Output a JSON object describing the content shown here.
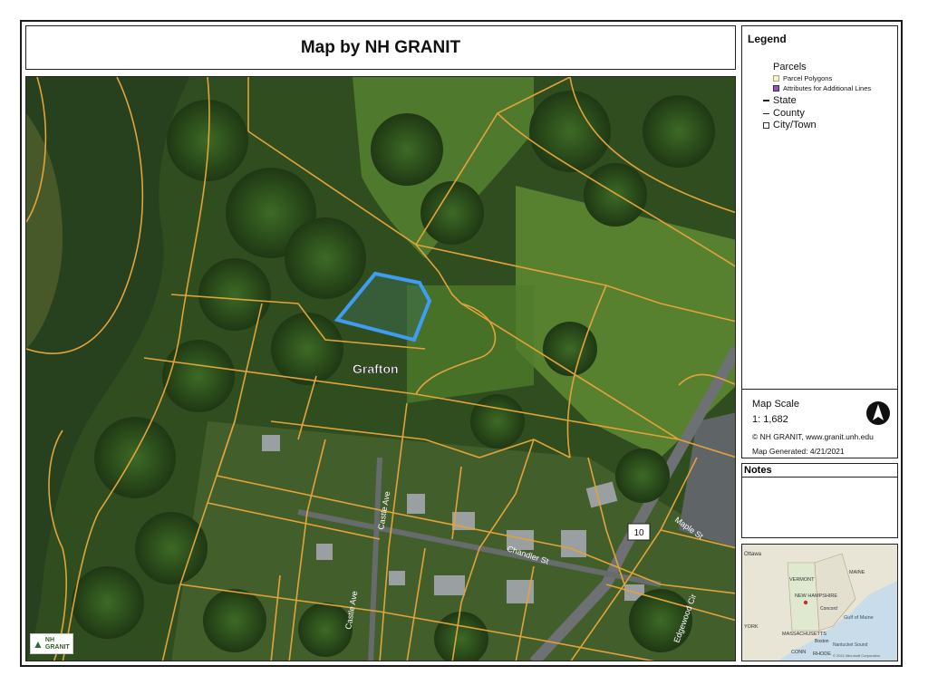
{
  "title": "Map by NH GRANIT",
  "legend": {
    "heading": "Legend",
    "group": "Parcels",
    "items": [
      {
        "label": "Parcel Polygons",
        "color": "#f2efe0",
        "icon": "parcel-polygon-swatch"
      },
      {
        "label": "Attributes for Additional Lines",
        "color": "#9b4fc7",
        "icon": "attribute-line-swatch"
      },
      {
        "label": "State",
        "icon": "state-line-symbol"
      },
      {
        "label": "County",
        "icon": "county-line-symbol"
      },
      {
        "label": "City/Town",
        "icon": "city-town-box-symbol"
      }
    ]
  },
  "scale": {
    "label": "Map Scale",
    "value": "1: 1,682",
    "credit": "© NH GRANIT, www.granit.unh.edu",
    "generated_label": "Map Generated:",
    "generated_date": "4/21/2021"
  },
  "notes": {
    "heading": "Notes"
  },
  "map_labels": {
    "town": "Grafton",
    "street_castle_1": "Castle Ave",
    "street_castle_2": "Castle Ave",
    "street_chandler": "Chandler St",
    "street_maple": "Maple St",
    "street_edgewood": "Edgewood Cir",
    "route_shield": "10"
  },
  "inset": {
    "labels": [
      "Ottawa",
      "VERMONT",
      "MAINE",
      "NEW HAMPSHIRE",
      "Gulf of Maine",
      "Concord",
      "YORK",
      "MASSACHUSETTS",
      "Boston",
      "CONN",
      "RHODE",
      "Nantucket Sound"
    ],
    "attribution": "© 2021 Microsoft Corporation"
  },
  "logo": {
    "line1": "NH",
    "line2": "GRANIT"
  },
  "colors": {
    "parcel_line": "#e2a33a",
    "selected_parcel": "#3f9cf2",
    "forest": "#2e4a1d",
    "river": "#28401f"
  }
}
